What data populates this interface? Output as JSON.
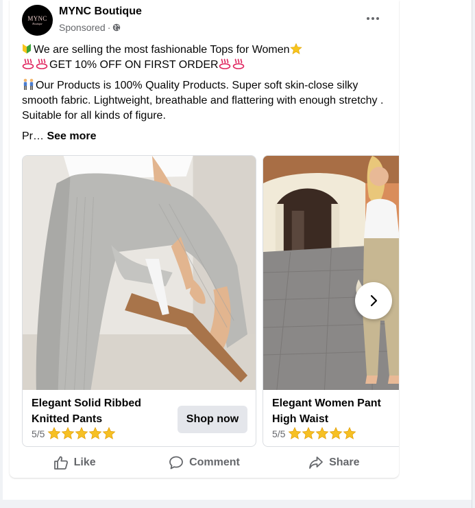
{
  "post": {
    "page_name": "MYNC Boutique",
    "avatar_logo": "MYNC",
    "avatar_logo_sub": "Boutique",
    "sponsored_label": "Sponsored",
    "sponsored_separator": "·",
    "line1": "We are selling the most fashionable Tops for Women",
    "line2": "GET 10% OFF ON FIRST ORDER",
    "para2": "Our Products is 100% Quality Products. Super soft skin-close silky smooth fabric. Lightweight, breathable and flattering with enough stretchy . Suitable for all kinds of figure.",
    "para3_prefix": "Pr…",
    "see_more": "See more"
  },
  "carousel": {
    "items": [
      {
        "title": "Elegant Solid Ribbed Knitted Pants",
        "rating_text": "5/5",
        "stars": 5,
        "cta": "Shop now"
      },
      {
        "title": "Elegant Women Pant High Waist",
        "rating_text": "5/5",
        "stars": 5
      }
    ]
  },
  "actions": {
    "like": "Like",
    "comment": "Comment",
    "share": "Share"
  },
  "colors": {
    "text_primary": "#050505",
    "text_secondary": "#65676b",
    "button_bg": "#e4e6eb",
    "star": "#f6c024"
  },
  "icons": [
    "globe-icon",
    "more-icon",
    "chevron-right-icon",
    "like-icon",
    "comment-icon",
    "share-icon",
    "star-icon"
  ]
}
